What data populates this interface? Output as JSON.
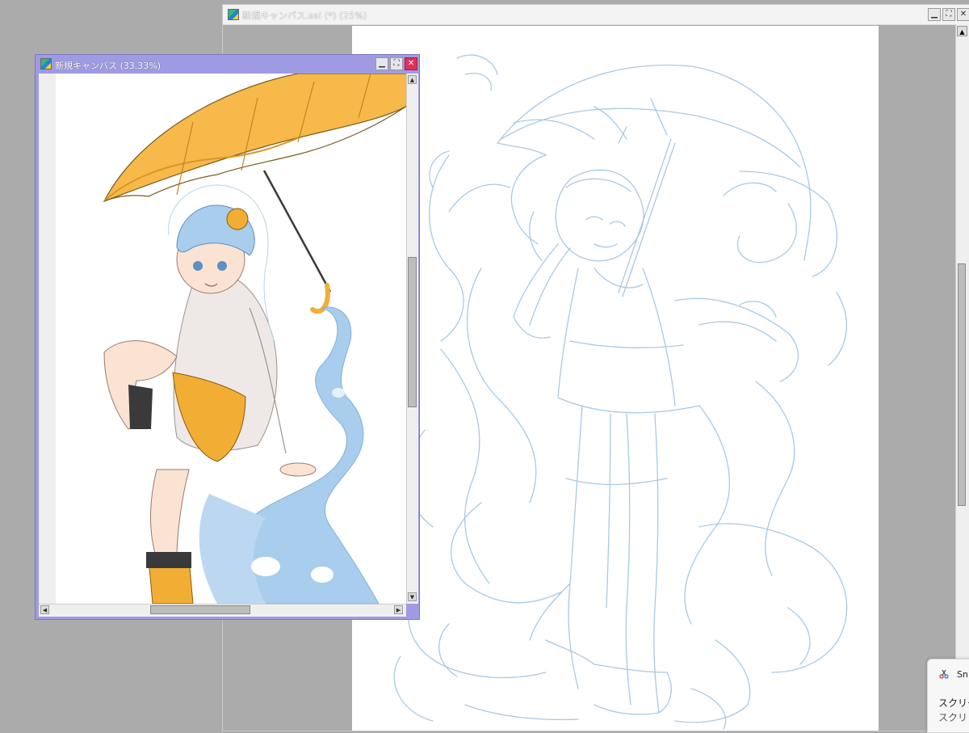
{
  "back_window": {
    "title": "新規キャンバス.sai (*) (25%)",
    "minimize_icon": "minimize-icon",
    "maximize_icon": "maximize-icon",
    "close_icon": "close-icon"
  },
  "front_window": {
    "title": "新規キャンバス (33.33%)",
    "minimize_icon": "minimize-icon",
    "maximize_icon": "maximize-icon",
    "close_icon": "close-icon"
  },
  "snip_notification": {
    "app_name": "Sni",
    "line1": "スクリー",
    "line2": "スクリ"
  },
  "colors": {
    "front_titlebar": "#9f9be3",
    "back_titlebar": "#f3f3f3",
    "workspace": "#ababab",
    "sketch_line": "#a9c9e2",
    "umbrella": "#f6b94a",
    "water": "#a9cdec",
    "shorts": "#f2ae34"
  }
}
